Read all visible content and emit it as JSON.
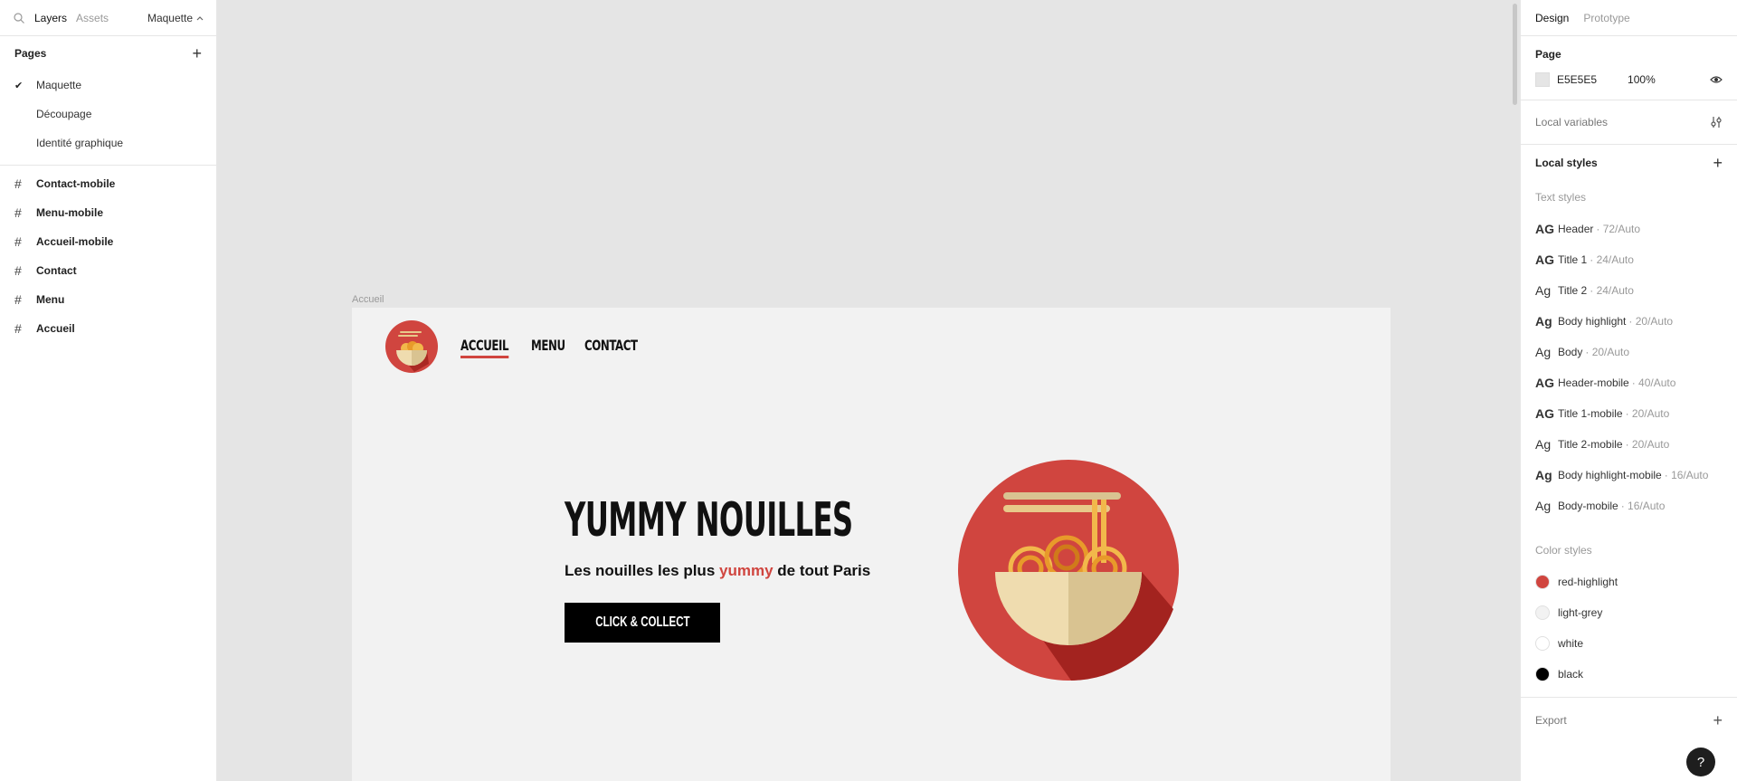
{
  "left_panel": {
    "tabs": [
      "Layers",
      "Assets"
    ],
    "page_selector": "Maquette",
    "pages_title": "Pages",
    "pages": [
      {
        "label": "Maquette",
        "selected": true
      },
      {
        "label": "Découpage",
        "selected": false
      },
      {
        "label": "Identité graphique",
        "selected": false
      }
    ],
    "layers": [
      "Contact-mobile",
      "Menu-mobile",
      "Accueil-mobile",
      "Contact",
      "Menu",
      "Accueil"
    ]
  },
  "canvas": {
    "frame_label": "Accueil",
    "nav": [
      "ACCUEIL",
      "MENU",
      "CONTACT"
    ],
    "hero_title": "YUMMY NOUILLES",
    "hero_sub_before": "Les nouilles les plus ",
    "hero_sub_highlight": "yummy",
    "hero_sub_after": " de tout Paris",
    "cta_label": "CLICK & COLLECT",
    "colors": {
      "red": "#d0453f",
      "dark_red": "#a3231f",
      "bowl": "#efdcaf",
      "noodle": "#f2b84b"
    }
  },
  "right_panel": {
    "tabs": [
      "Design",
      "Prototype"
    ],
    "page_title": "Page",
    "page_color": "E5E5E5",
    "page_opacity": "100%",
    "local_variables": "Local variables",
    "local_styles": "Local styles",
    "text_styles_title": "Text styles",
    "text_styles": [
      {
        "name": "Header",
        "meta": "· 72/Auto",
        "icon": "AG",
        "bold": true
      },
      {
        "name": "Title 1",
        "meta": "· 24/Auto",
        "icon": "AG",
        "bold": true
      },
      {
        "name": "Title 2",
        "meta": "· 24/Auto",
        "icon": "Ag",
        "bold": false
      },
      {
        "name": "Body highlight",
        "meta": "· 20/Auto",
        "icon": "Ag",
        "bold": true
      },
      {
        "name": "Body",
        "meta": "· 20/Auto",
        "icon": "Ag",
        "bold": false
      },
      {
        "name": "Header-mobile",
        "meta": "· 40/Auto",
        "icon": "AG",
        "bold": true
      },
      {
        "name": "Title 1-mobile",
        "meta": "· 20/Auto",
        "icon": "AG",
        "bold": true
      },
      {
        "name": "Title 2-mobile",
        "meta": "· 20/Auto",
        "icon": "Ag",
        "bold": false
      },
      {
        "name": "Body highlight-mobile",
        "meta": "· 16/Auto",
        "icon": "Ag",
        "bold": true
      },
      {
        "name": "Body-mobile",
        "meta": "· 16/Auto",
        "icon": "Ag",
        "bold": false
      }
    ],
    "color_styles_title": "Color styles",
    "color_styles": [
      {
        "name": "red-highlight",
        "color": "#d0453f"
      },
      {
        "name": "light-grey",
        "color": "#f2f2f2"
      },
      {
        "name": "white",
        "color": "#ffffff"
      },
      {
        "name": "black",
        "color": "#000000"
      }
    ],
    "export": "Export",
    "help": "?"
  }
}
